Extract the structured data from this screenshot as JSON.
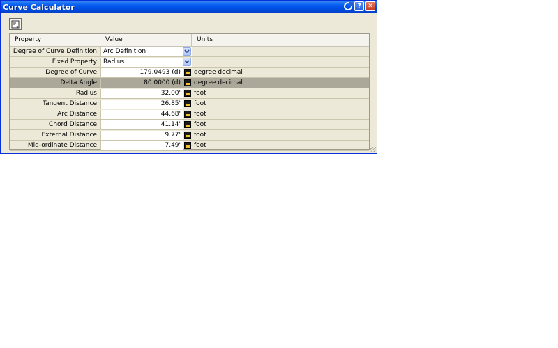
{
  "window": {
    "title": "Curve Calculator"
  },
  "grid": {
    "headers": [
      "Property",
      "Value",
      "Units"
    ],
    "rows": [
      {
        "property": "Degree of Curve Definition",
        "value": "Arc Definition",
        "unit": ""
      },
      {
        "property": "Fixed Property",
        "value": "Radius",
        "unit": ""
      },
      {
        "property": "Degree of Curve",
        "value": "179.0493 (d)",
        "unit": "degree decimal"
      },
      {
        "property": "Delta Angle",
        "value": "80.0000 (d)",
        "unit": "degree decimal"
      },
      {
        "property": "Radius",
        "value": "32.00'",
        "unit": "foot"
      },
      {
        "property": "Tangent Distance",
        "value": "26.85'",
        "unit": "foot"
      },
      {
        "property": "Arc Distance",
        "value": "44.68'",
        "unit": "foot"
      },
      {
        "property": "Chord Distance",
        "value": "41.14'",
        "unit": "foot"
      },
      {
        "property": "External Distance",
        "value": "9.77'",
        "unit": "foot"
      },
      {
        "property": "Mid-ordinate Distance",
        "value": "7.49'",
        "unit": "foot"
      }
    ]
  },
  "icons": {
    "tool": "calculator-toolbar-icon",
    "dropdown": "chevron-down-icon",
    "calc": "calculator-icon"
  },
  "colors": {
    "titlebar": "#0058ee",
    "selected_row": "#aca899",
    "window_bg": "#ece9d8"
  }
}
